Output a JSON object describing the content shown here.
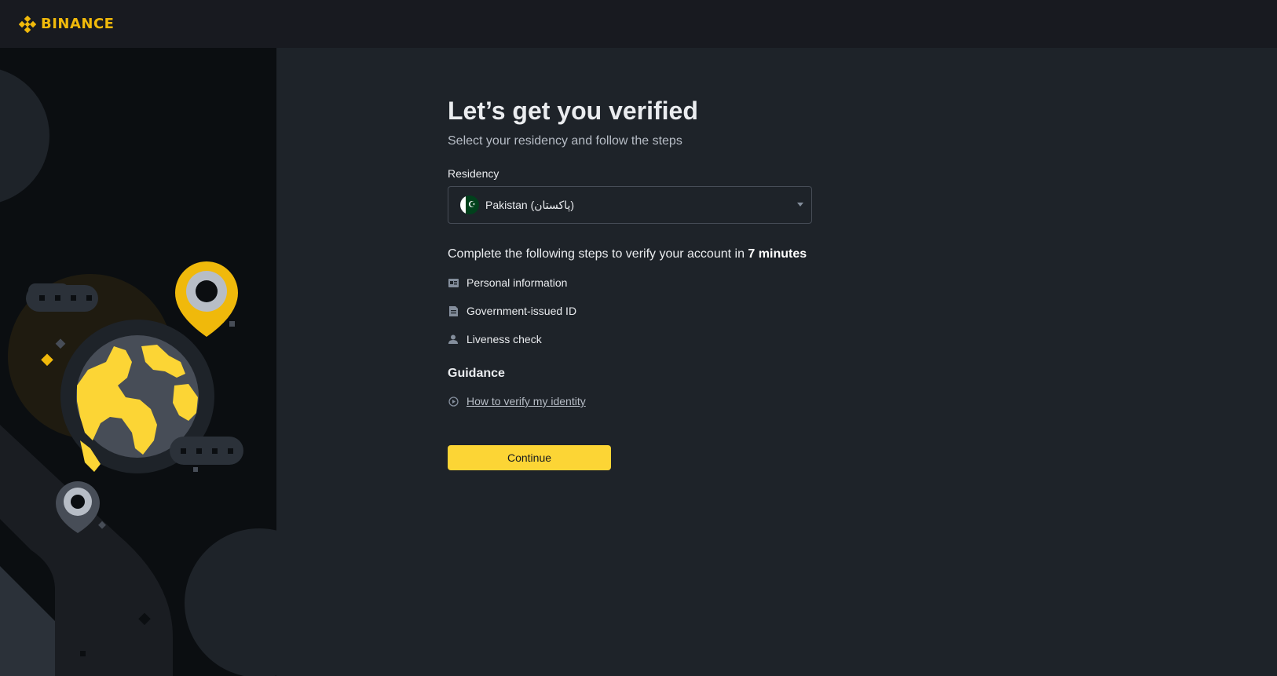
{
  "header": {
    "logo_text": "BINANCE",
    "brand_color": "#f0b90b"
  },
  "page": {
    "title": "Let’s get you verified",
    "subtitle": "Select your residency and follow the steps"
  },
  "residency": {
    "label": "Residency",
    "selected": "Pakistan (پاکستان)",
    "flag_icon": "pakistan-flag-icon"
  },
  "steps": {
    "intro": "Complete the following steps to verify your account in ",
    "duration": "7 minutes",
    "items": [
      {
        "label": "Personal information",
        "icon": "id-card-icon"
      },
      {
        "label": "Government-issued ID",
        "icon": "document-icon"
      },
      {
        "label": "Liveness check",
        "icon": "person-icon"
      }
    ]
  },
  "guidance": {
    "heading": "Guidance",
    "link": "How to verify my identity",
    "link_icon": "play-circle-icon"
  },
  "actions": {
    "continue_label": "Continue",
    "accent_color": "#fcd535"
  }
}
